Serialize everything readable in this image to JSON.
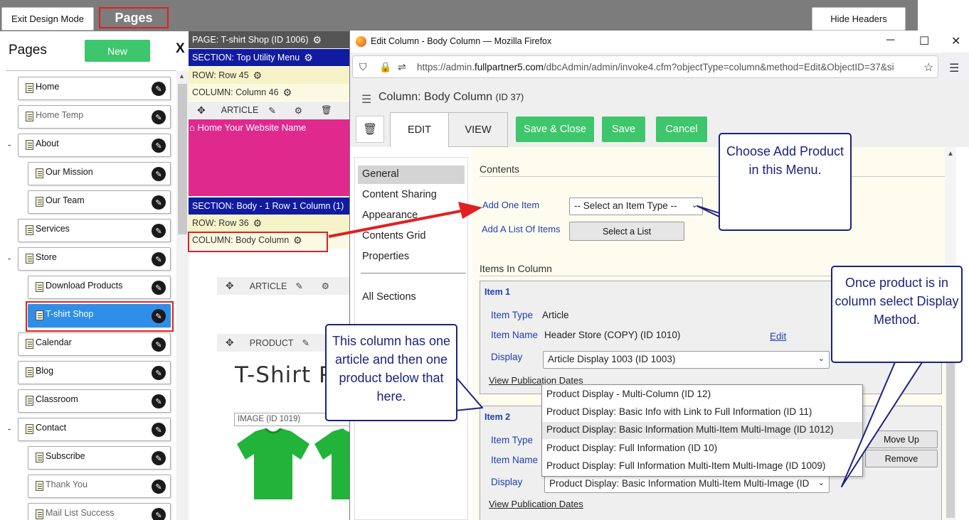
{
  "topbar": {
    "exit_design_label": "Exit Design Mode",
    "pages_tab_label": "Pages",
    "hide_headers_label": "Hide Headers"
  },
  "pages_panel": {
    "title": "Pages",
    "new_label": "New",
    "close_label": "X",
    "items": [
      {
        "label": "Home",
        "indent": 0,
        "collapsible": false,
        "muted": false,
        "selected": false
      },
      {
        "label": "Home Temp",
        "indent": 0,
        "collapsible": false,
        "muted": true,
        "selected": false
      },
      {
        "label": "About",
        "indent": 0,
        "collapsible": true,
        "muted": false,
        "selected": false
      },
      {
        "label": "Our Mission",
        "indent": 1,
        "collapsible": false,
        "muted": false,
        "selected": false
      },
      {
        "label": "Our Team",
        "indent": 1,
        "collapsible": false,
        "muted": false,
        "selected": false
      },
      {
        "label": "Services",
        "indent": 0,
        "collapsible": false,
        "muted": false,
        "selected": false
      },
      {
        "label": "Store",
        "indent": 0,
        "collapsible": true,
        "muted": false,
        "selected": false
      },
      {
        "label": "Download Products",
        "indent": 1,
        "collapsible": false,
        "muted": false,
        "selected": false
      },
      {
        "label": "T-shirt Shop",
        "indent": 1,
        "collapsible": false,
        "muted": false,
        "selected": true
      },
      {
        "label": "Calendar",
        "indent": 0,
        "collapsible": false,
        "muted": false,
        "selected": false
      },
      {
        "label": "Blog",
        "indent": 0,
        "collapsible": false,
        "muted": false,
        "selected": false
      },
      {
        "label": "Classroom",
        "indent": 0,
        "collapsible": false,
        "muted": false,
        "selected": false
      },
      {
        "label": "Contact",
        "indent": 0,
        "collapsible": true,
        "muted": false,
        "selected": false
      },
      {
        "label": "Subscribe",
        "indent": 1,
        "collapsible": false,
        "muted": false,
        "selected": false
      },
      {
        "label": "Thank You",
        "indent": 1,
        "collapsible": false,
        "muted": true,
        "selected": false
      },
      {
        "label": "Mail List Success",
        "indent": 1,
        "collapsible": false,
        "muted": true,
        "selected": false
      }
    ]
  },
  "design": {
    "page_bar": "PAGE: T-shirt Shop (ID 1006)",
    "section_top": "SECTION: Top Utility Menu",
    "row_45": "ROW: Row 45",
    "column_46": "COLUMN: Column 46",
    "article_label": "ARTICLE",
    "home_link": "⌂ Home Your Website Name",
    "section_body": "SECTION: Body - 1 Row 1 Column (1)",
    "row_36": "ROW: Row 36",
    "column_body": "COLUMN: Body Column",
    "article_label_2": "ARTICLE",
    "product_label": "PRODUCT",
    "big_title": "T-Shirt P",
    "image_label": "IMAGE (ID 1019)"
  },
  "firefox": {
    "window_title": "Edit Column - Body Column — Mozilla Firefox",
    "url_prefix": "https://admin.",
    "url_domain": "fullpartner5.com",
    "url_rest": "/dbcAdmin/admin/invoke4.cfm?objectType=column&method=Edit&ObjectID=37&si"
  },
  "editor": {
    "title": "Column: Body Column",
    "title_id": "(ID 37)",
    "tabs": [
      "EDIT",
      "VIEW"
    ],
    "save_close_label": "Save & Close",
    "save_label": "Save",
    "cancel_label": "Cancel",
    "nav": [
      "General",
      "Content Sharing",
      "Appearance",
      "Contents Grid",
      "Properties",
      "All Sections"
    ],
    "contents_heading": "Contents",
    "add_one_item_label": "Add One Item",
    "add_one_item_value": "-- Select an Item Type --",
    "add_list_label": "Add A List Of Items",
    "select_list_label": "Select a List",
    "items_heading": "Items In Column",
    "item1": {
      "title": "Item 1",
      "type_label": "Item Type",
      "type_value": "Article",
      "name_label": "Item Name",
      "name_value": "Header Store (COPY) (ID 1010)",
      "edit_label": "Edit",
      "display_label": "Display",
      "display_value": "Article Display 1003 (ID 1003)",
      "pub_dates": "View Publication Dates"
    },
    "item2": {
      "title": "Item 2",
      "type_label": "Item Type",
      "name_label": "Item Name",
      "display_label": "Display",
      "display_value": "Product Display: Basic Information Multi-Item Multi-Image (ID",
      "move_up_label": "Move Up",
      "remove_label": "Remove",
      "pub_dates": "View Publication Dates"
    },
    "display_options": [
      "Product Display - Multi-Column (ID 12)",
      "Product Display: Basic Info with Link to Full Information (ID 11)",
      "Product Display: Basic Information Multi-Item Multi-Image (ID 1012)",
      "Product Display: Full Information (ID 10)",
      "Product Display: Full Information Multi-Item Multi-Image (ID 1009)"
    ]
  },
  "callouts": {
    "choose_add": "Choose Add Product in this Menu.",
    "once_product": "Once product is in column select Display Method.",
    "this_column": "This column has one article and then one product below that here."
  },
  "colors": {
    "green": "#3ec66c",
    "section_blue": "#111ba0",
    "magenta": "#e0298d",
    "highlight_red": "#e02020",
    "selected_blue": "#2f8ee8",
    "callout_navy": "#1a237e"
  }
}
